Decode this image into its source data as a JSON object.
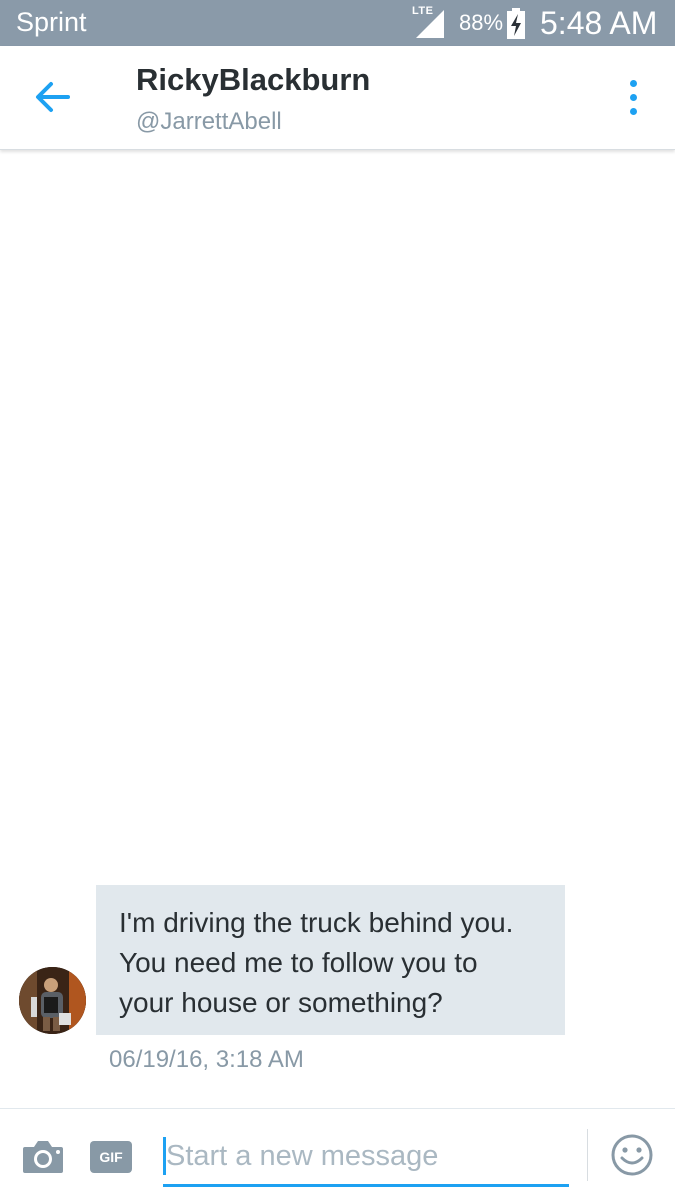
{
  "status_bar": {
    "carrier": "Sprint",
    "network": "LTE",
    "battery": "88%",
    "time": "5:48 AM",
    "icons": [
      "signal-icon",
      "battery-charging-icon"
    ]
  },
  "header": {
    "name": "RickyBlackburn",
    "handle": "@JarrettAbell",
    "icons": [
      "back-arrow-icon",
      "more-vertical-icon"
    ]
  },
  "conversation": {
    "messages": [
      {
        "text": "I'm driving the truck behind you.\nYou need me to follow you to\nyour house or something?",
        "timestamp": "06/19/16, 3:18 AM"
      }
    ]
  },
  "compose": {
    "placeholder": "Start a new message",
    "gif_label": "GIF",
    "icons": [
      "camera-icon",
      "emoji-icon"
    ]
  },
  "colors": {
    "accent": "#1da1f2",
    "status_bar": "#8a9aa9",
    "bubble": "#e1e8ed",
    "muted_text": "#8899a6"
  }
}
